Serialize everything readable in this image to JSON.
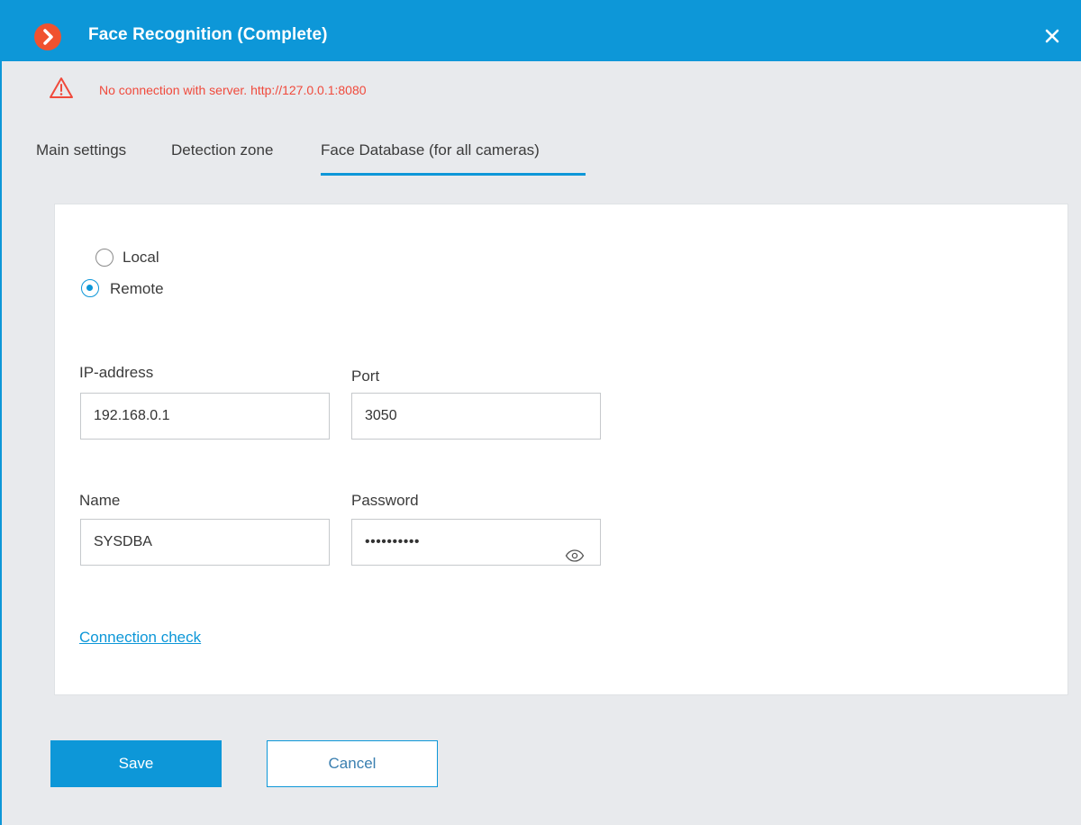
{
  "window": {
    "title": "Face Recognition (Complete)",
    "accent_color": "#0d97d8",
    "icon": "chevron-right-icon",
    "icon_color": "#f0522f"
  },
  "warning": {
    "icon": "warning-triangle-icon",
    "text": "No connection with server. http://127.0.0.1:8080",
    "color": "#f04a3c"
  },
  "tabs": [
    {
      "label": "Main settings",
      "active": false
    },
    {
      "label": "Detection zone",
      "active": false
    },
    {
      "label": "Face Database (for all cameras)",
      "active": true
    }
  ],
  "database_mode": {
    "options": [
      {
        "label": "Local",
        "checked": false
      },
      {
        "label": "Remote",
        "checked": true
      }
    ]
  },
  "fields": {
    "ip": {
      "label": "IP-address",
      "value": "192.168.0.1"
    },
    "port": {
      "label": "Port",
      "value": "3050"
    },
    "name": {
      "label": "Name",
      "value": "SYSDBA"
    },
    "password": {
      "label": "Password",
      "value": "••••••••••",
      "reveal_icon": "eye-icon"
    }
  },
  "connection_check": "Connection check",
  "buttons": {
    "save": "Save",
    "cancel": "Cancel"
  }
}
